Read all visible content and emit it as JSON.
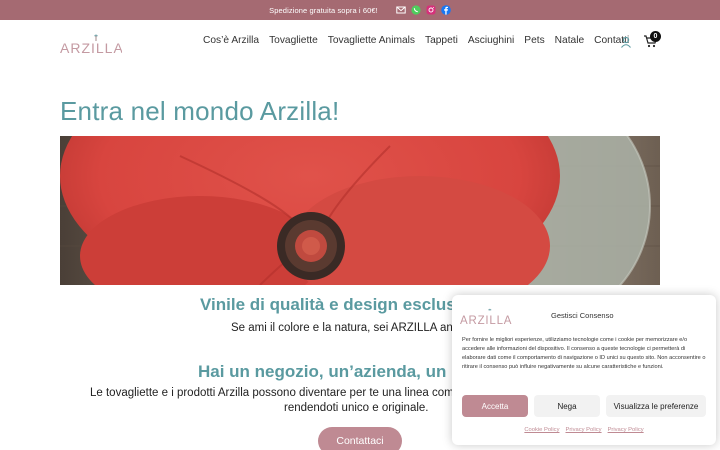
{
  "topbar": {
    "text": "Spedizione gratuita sopra i 60€!",
    "icons": [
      "mail-icon",
      "whatsapp-icon",
      "instagram-icon",
      "facebook-icon"
    ]
  },
  "header": {
    "logo_text": "ARZILLA",
    "nav": [
      {
        "label": "Cos’è Arzilla"
      },
      {
        "label": "Tovagliette"
      },
      {
        "label": "Tovagliette Animals"
      },
      {
        "label": "Tappeti"
      },
      {
        "label": "Asciughini"
      },
      {
        "label": "Pets"
      },
      {
        "label": "Natale"
      },
      {
        "label": "Contatti"
      }
    ],
    "cart_count": "0"
  },
  "main": {
    "title": "Entra nel mondo Arzilla!",
    "subtitle1": "Vinile di qualità e design esclusivo",
    "paragraph1": "Se ami il colore e la natura, sei ARZILLA anche tu!",
    "subtitle2": "Hai un negozio, un’azienda, un ristorante?",
    "paragraph2_line1": "Le tovagliette e i prodotti Arzilla possono diventare per te una linea completamente personalizzata,",
    "paragraph2_line2": "rendendoti unico e originale.",
    "cta": "Contattaci"
  },
  "consent": {
    "title": "Gestisci Consenso",
    "text": "Per fornire le migliori esperienze, utilizziamo tecnologie come i cookie per memorizzare e/o accedere alle informazioni del dispositivo. Il consenso a queste tecnologie ci permetterà di elaborare dati come il comportamento di navigazione o ID unici su questo sito. Non acconsentire o ritirare il consenso può influire negativamente su alcune caratteristiche e funzioni.",
    "accept": "Accetta",
    "deny": "Nega",
    "preferences": "Visualizza le preferenze",
    "links": [
      "Cookie Policy",
      "Privacy Policy",
      "Privacy Policy"
    ]
  },
  "colors": {
    "topbar": "#a56a72",
    "accent_teal": "#5a9aa0",
    "accent_pink": "#bf8a93"
  }
}
